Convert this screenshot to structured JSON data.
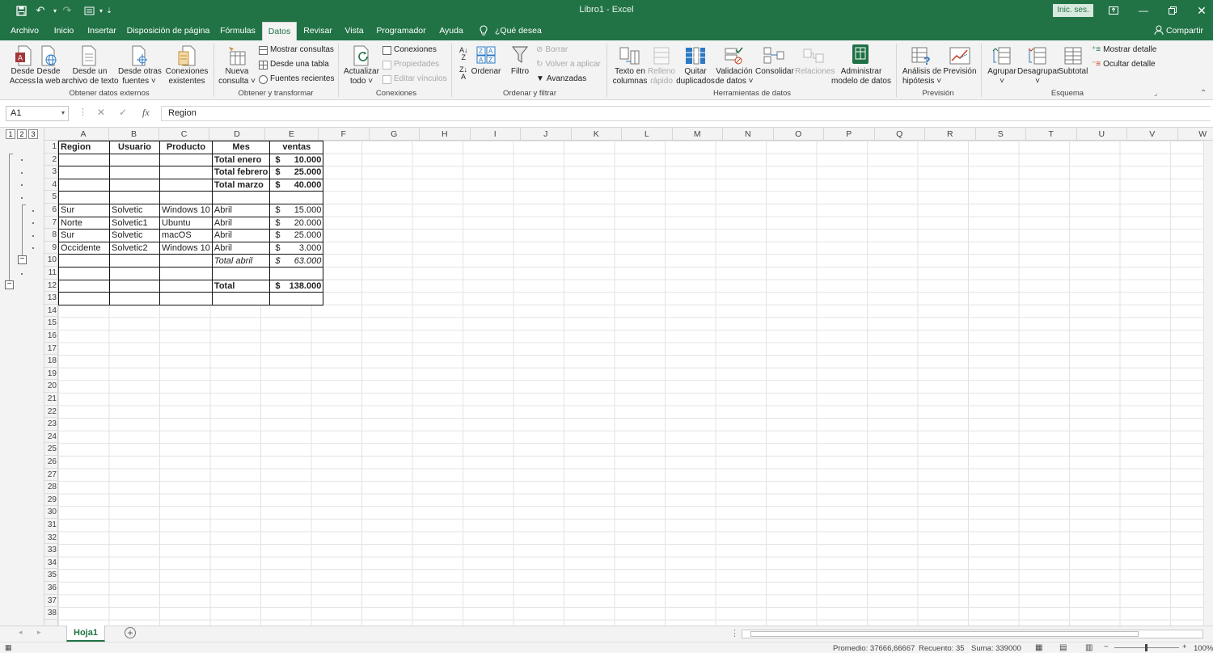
{
  "app": {
    "title": "Libro1  -  Excel",
    "signin": "Inic. ses.",
    "share": "Compartir",
    "colors": {
      "brand": "#217346"
    }
  },
  "tabs": [
    "Archivo",
    "Inicio",
    "Insertar",
    "Disposición de página",
    "Fórmulas",
    "Datos",
    "Revisar",
    "Vista",
    "Programador",
    "Ayuda"
  ],
  "active_tab": "Datos",
  "tell_me": "¿Qué desea hacer?",
  "ribbon": {
    "obtener_externos": {
      "name": "Obtener datos externos",
      "access": [
        "Desde",
        "Access"
      ],
      "web": [
        "Desde",
        "la web"
      ],
      "texto": [
        "Desde un",
        "archivo de texto"
      ],
      "otras": [
        "Desde otras",
        "fuentes ˅"
      ],
      "existentes": [
        "Conexiones",
        "existentes"
      ]
    },
    "transformar": {
      "name": "Obtener y transformar",
      "nueva": [
        "Nueva",
        "consulta ˅"
      ],
      "mostrar": "Mostrar consultas",
      "tabla": "Desde una tabla",
      "recientes": "Fuentes recientes"
    },
    "conexiones": {
      "name": "Conexiones",
      "actualizar": [
        "Actualizar",
        "todo ˅"
      ],
      "conexiones": "Conexiones",
      "propiedades": "Propiedades",
      "editar": "Editar vínculos"
    },
    "ordenar": {
      "name": "Ordenar y filtrar",
      "ordenar": "Ordenar",
      "filtro": "Filtro",
      "borrar": "Borrar",
      "volver": "Volver a aplicar",
      "avanzadas": "Avanzadas"
    },
    "herramientas": {
      "name": "Herramientas de datos",
      "texto": [
        "Texto en",
        "columnas"
      ],
      "relleno": [
        "Relleno",
        "rápido"
      ],
      "quitar": [
        "Quitar",
        "duplicados"
      ],
      "validacion": [
        "Validación",
        "de datos ˅"
      ],
      "consolidar": "Consolidar",
      "relaciones": "Relaciones",
      "modelo": [
        "Administrar",
        "modelo de datos"
      ]
    },
    "prevision": {
      "name": "Previsión",
      "hipotesis": [
        "Análisis de",
        "hipótesis ˅"
      ],
      "prevision": "Previsión"
    },
    "esquema": {
      "name": "Esquema",
      "agrupar": [
        "Agrupar",
        "˅"
      ],
      "desagrupar": [
        "Desagrupar",
        "˅"
      ],
      "subtotal": "Subtotal",
      "mostrar": "Mostrar detalle",
      "ocultar": "Ocultar detalle"
    }
  },
  "formula_bar": {
    "name_box": "A1",
    "content": "Region"
  },
  "outline_levels": [
    "1",
    "2",
    "3"
  ],
  "columns": [
    "A",
    "B",
    "C",
    "D",
    "E",
    "F",
    "G",
    "H",
    "I",
    "J",
    "K",
    "L",
    "M",
    "N",
    "O",
    "P",
    "Q",
    "R",
    "S",
    "T",
    "U",
    "V",
    "W"
  ],
  "rows": [
    "1",
    "2",
    "3",
    "4",
    "5",
    "6",
    "7",
    "8",
    "9",
    "10",
    "11",
    "12",
    "13",
    "14",
    "15",
    "16",
    "17",
    "18",
    "19",
    "20",
    "21",
    "22",
    "23",
    "24",
    "25",
    "26",
    "27",
    "28",
    "29",
    "30",
    "31",
    "32",
    "33",
    "34",
    "35",
    "36",
    "37",
    "38"
  ],
  "table": {
    "headers": [
      "Region",
      "Usuario",
      "Producto",
      "Mes",
      "ventas"
    ],
    "rows": [
      [
        "",
        "",
        "",
        "Total enero",
        "$",
        "10.000"
      ],
      [
        "",
        "",
        "",
        "Total febrero",
        "$",
        "25.000"
      ],
      [
        "",
        "",
        "",
        "Total marzo",
        "$",
        "40.000"
      ],
      [
        "",
        "",
        "",
        "",
        "",
        ""
      ],
      [
        "Sur",
        "Solvetic",
        "Windows 10",
        "Abril",
        "$",
        "15.000"
      ],
      [
        "Norte",
        "Solvetic1",
        "Ubuntu",
        "Abril",
        "$",
        "20.000"
      ],
      [
        "Sur",
        "Solvetic",
        "macOS",
        "Abril",
        "$",
        "25.000"
      ],
      [
        "Occidente",
        "Solvetic2",
        "Windows 10",
        "Abril",
        "$",
        "3.000"
      ],
      [
        "",
        "",
        "",
        "Total abril",
        "$",
        "63.000"
      ],
      [
        "",
        "",
        "",
        "",
        "",
        ""
      ],
      [
        "",
        "",
        "",
        "Total",
        "$",
        "138.000"
      ],
      [
        "",
        "",
        "",
        "",
        "",
        ""
      ]
    ]
  },
  "sheet_tab": "Hoja1",
  "status": {
    "promedio": "Promedio: 37666,66667",
    "recuento": "Recuento: 35",
    "suma": "Suma: 339000",
    "zoom": "100%"
  }
}
